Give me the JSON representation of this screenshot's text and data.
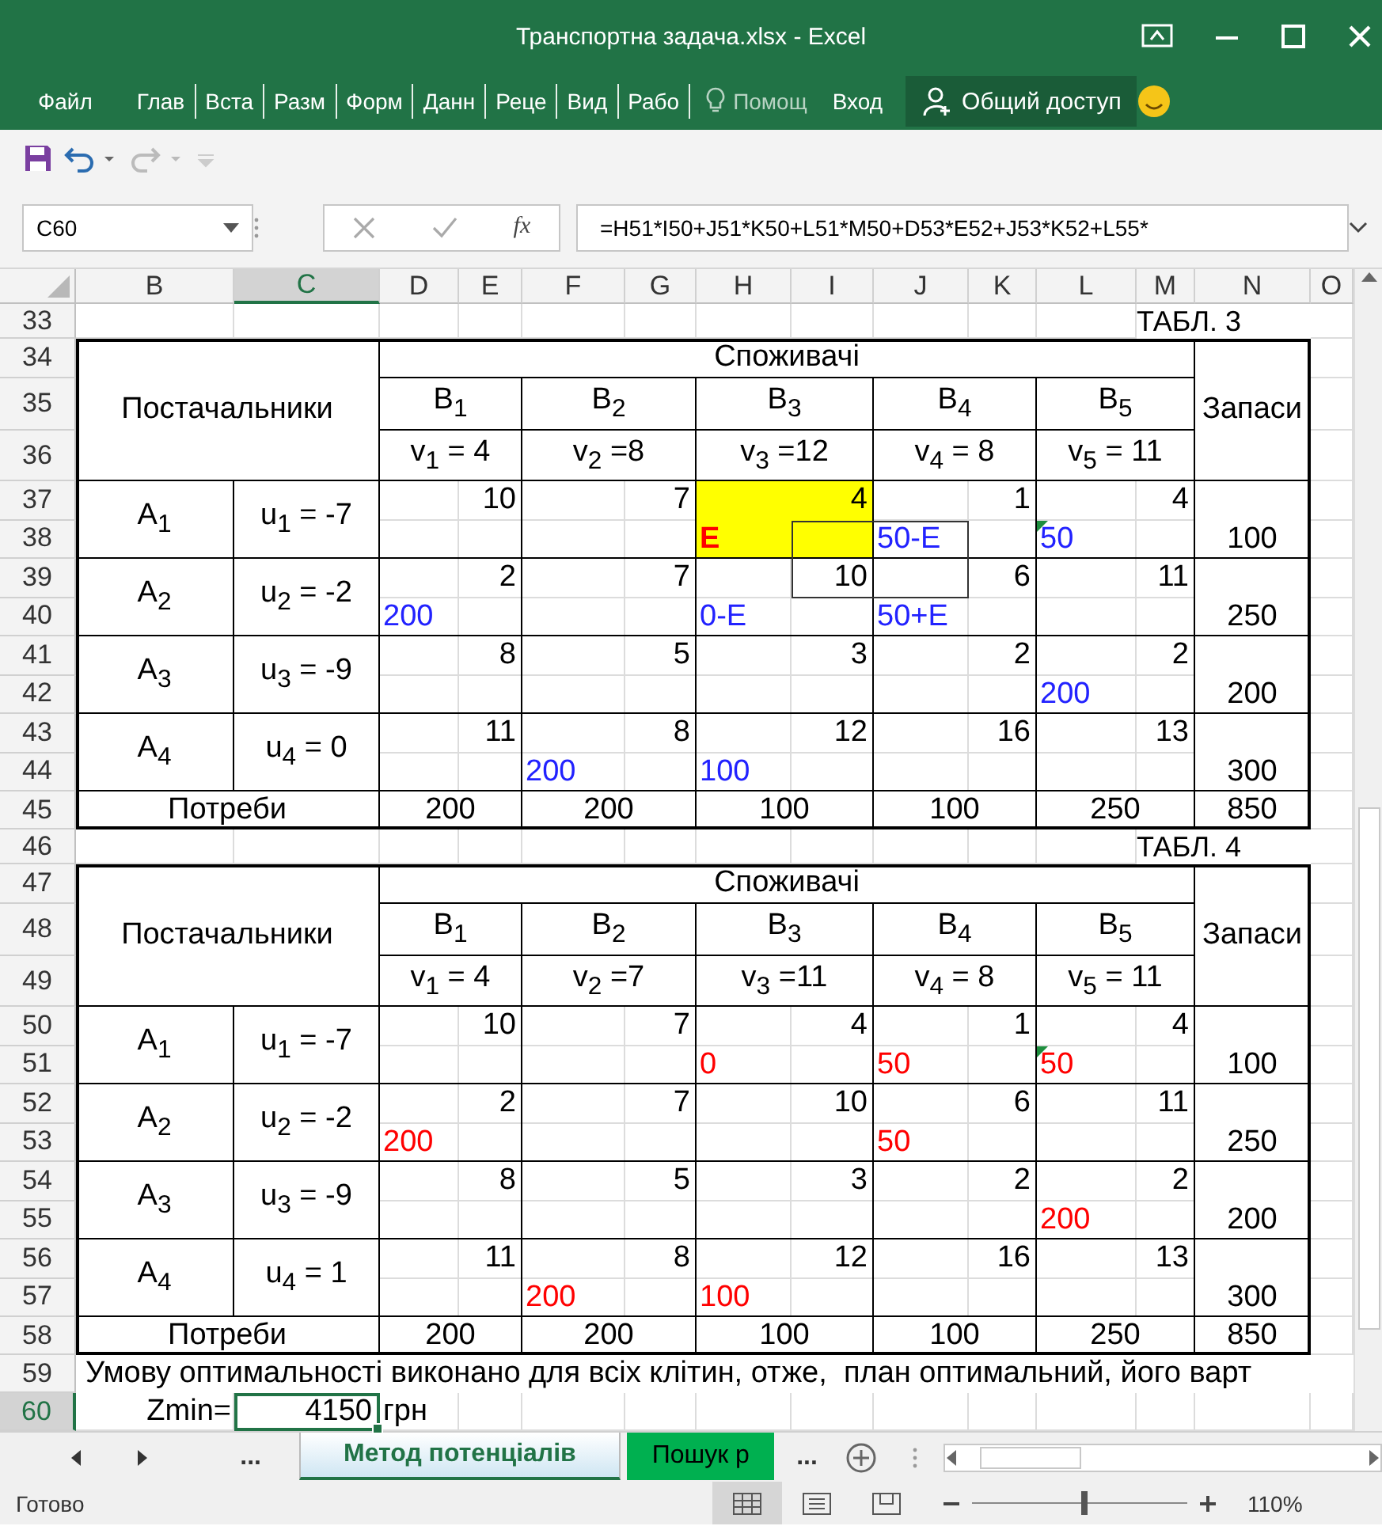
{
  "window": {
    "title": "Транспортна задача.xlsx - Excel"
  },
  "ribbon": {
    "tabs": [
      {
        "label": "Файл"
      },
      {
        "label": "Глав"
      },
      {
        "label": "Вста"
      },
      {
        "label": "Разм"
      },
      {
        "label": "Форм"
      },
      {
        "label": "Данн"
      },
      {
        "label": "Реце"
      },
      {
        "label": "Вид"
      },
      {
        "label": "Рабо"
      }
    ],
    "tell_me": "Помощ",
    "sign_in": "Вход",
    "share": "Общий доступ"
  },
  "formula_bar": {
    "name_box": "C60",
    "function_label": "fx",
    "formula": "=H51*I50+J51*K50+L51*M50+D53*E52+J53*K52+L55*"
  },
  "columns": [
    {
      "label": "B",
      "selected": false
    },
    {
      "label": "C",
      "selected": true
    },
    {
      "label": "D",
      "selected": false
    },
    {
      "label": "E",
      "selected": false
    },
    {
      "label": "F",
      "selected": false
    },
    {
      "label": "G",
      "selected": false
    },
    {
      "label": "H",
      "selected": false
    },
    {
      "label": "I",
      "selected": false
    },
    {
      "label": "J",
      "selected": false
    },
    {
      "label": "K",
      "selected": false
    },
    {
      "label": "L",
      "selected": false
    },
    {
      "label": "M",
      "selected": false
    },
    {
      "label": "N",
      "selected": false
    },
    {
      "label": "O",
      "selected": false
    }
  ],
  "row_headers": [
    {
      "label": "33",
      "selected": false
    },
    {
      "label": "34",
      "selected": false
    },
    {
      "label": "35",
      "selected": false
    },
    {
      "label": "36",
      "selected": false
    },
    {
      "label": "37",
      "selected": false
    },
    {
      "label": "38",
      "selected": false
    },
    {
      "label": "39",
      "selected": false
    },
    {
      "label": "40",
      "selected": false
    },
    {
      "label": "41",
      "selected": false
    },
    {
      "label": "42",
      "selected": false
    },
    {
      "label": "43",
      "selected": false
    },
    {
      "label": "44",
      "selected": false
    },
    {
      "label": "45",
      "selected": false
    },
    {
      "label": "46",
      "selected": false
    },
    {
      "label": "47",
      "selected": false
    },
    {
      "label": "48",
      "selected": false
    },
    {
      "label": "49",
      "selected": false
    },
    {
      "label": "50",
      "selected": false
    },
    {
      "label": "51",
      "selected": false
    },
    {
      "label": "52",
      "selected": false
    },
    {
      "label": "53",
      "selected": false
    },
    {
      "label": "54",
      "selected": false
    },
    {
      "label": "55",
      "selected": false
    },
    {
      "label": "56",
      "selected": false
    },
    {
      "label": "57",
      "selected": false
    },
    {
      "label": "58",
      "selected": false
    },
    {
      "label": "59",
      "selected": false
    },
    {
      "label": "60",
      "selected": true
    }
  ],
  "tables": [
    {
      "label": "ТАБЛ. 3",
      "suppliers_label": "Постачальники",
      "consumers_label": "Споживачі",
      "stock_label": "Запаси",
      "demand_label": "Потреби",
      "total": "850",
      "cycle_outline": true,
      "consumers": [
        {
          "name": "B$_{1}$",
          "potential": "v$_{1}$ = 4",
          "demand": "200"
        },
        {
          "name": "B$_{2}$",
          "potential": "v$_{2}$ =8",
          "demand": "200"
        },
        {
          "name": "B$_{3}$",
          "potential": "v$_{3}$ =12",
          "demand": "100"
        },
        {
          "name": "B$_{4}$",
          "potential": "v$_{4}$ = 8",
          "demand": "100"
        },
        {
          "name": "B$_{5}$",
          "potential": "v$_{5}$ = 11",
          "demand": "250"
        }
      ],
      "suppliers": [
        {
          "name": "A$_{1}$",
          "potential": "u$_{1}$ = -7",
          "stock": "100",
          "cells": [
            {
              "cost": "10",
              "highlighted": false,
              "flagged": false
            },
            {
              "cost": "7",
              "highlighted": false,
              "flagged": false
            },
            {
              "cost": "4",
              "highlighted": true,
              "flagged": false,
              "amount": {
                "text": "E",
                "color": "#ff0000",
                "bold": true
              }
            },
            {
              "cost": "1",
              "highlighted": false,
              "flagged": false,
              "amount": {
                "text": "50-E",
                "color": "#2222ff",
                "bold": false
              }
            },
            {
              "cost": "4",
              "highlighted": false,
              "flagged": true,
              "amount": {
                "text": "50",
                "color": "#2222ff",
                "bold": false
              }
            }
          ]
        },
        {
          "name": "A$_{2}$",
          "potential": "u$_{2}$ = -2",
          "stock": "250",
          "cells": [
            {
              "cost": "2",
              "highlighted": false,
              "flagged": false,
              "amount": {
                "text": "200",
                "color": "#2222ff",
                "bold": false
              }
            },
            {
              "cost": "7",
              "highlighted": false,
              "flagged": false
            },
            {
              "cost": "10",
              "highlighted": false,
              "flagged": false,
              "amount": {
                "text": "0-E",
                "color": "#2222ff",
                "bold": false
              }
            },
            {
              "cost": "6",
              "highlighted": false,
              "flagged": false,
              "amount": {
                "text": "50+E",
                "color": "#2222ff",
                "bold": false
              }
            },
            {
              "cost": "11",
              "highlighted": false,
              "flagged": false
            }
          ]
        },
        {
          "name": "A$_{3}$",
          "potential": "u$_{3}$ = -9",
          "stock": "200",
          "cells": [
            {
              "cost": "8",
              "highlighted": false,
              "flagged": false
            },
            {
              "cost": "5",
              "highlighted": false,
              "flagged": false
            },
            {
              "cost": "3",
              "highlighted": false,
              "flagged": false
            },
            {
              "cost": "2",
              "highlighted": false,
              "flagged": false
            },
            {
              "cost": "2",
              "highlighted": false,
              "flagged": false,
              "amount": {
                "text": "200",
                "color": "#2222ff",
                "bold": false
              }
            }
          ]
        },
        {
          "name": "A$_{4}$",
          "potential": "u$_{4}$ = 0",
          "stock": "300",
          "cells": [
            {
              "cost": "11",
              "highlighted": false,
              "flagged": false
            },
            {
              "cost": "8",
              "highlighted": false,
              "flagged": false,
              "amount": {
                "text": "200",
                "color": "#2222ff",
                "bold": false
              }
            },
            {
              "cost": "12",
              "highlighted": false,
              "flagged": false,
              "amount": {
                "text": "100",
                "color": "#2222ff",
                "bold": false
              }
            },
            {
              "cost": "16",
              "highlighted": false,
              "flagged": false
            },
            {
              "cost": "13",
              "highlighted": false,
              "flagged": false
            }
          ]
        }
      ]
    },
    {
      "label": "ТАБЛ. 4",
      "suppliers_label": "Постачальники",
      "consumers_label": "Споживачі",
      "stock_label": "Запаси",
      "demand_label": "Потреби",
      "total": "850",
      "cycle_outline": false,
      "consumers": [
        {
          "name": "B$_{1}$",
          "potential": "v$_{1}$ = 4",
          "demand": "200"
        },
        {
          "name": "B$_{2}$",
          "potential": "v$_{2}$ =7",
          "demand": "200"
        },
        {
          "name": "B$_{3}$",
          "potential": "v$_{3}$ =11",
          "demand": "100"
        },
        {
          "name": "B$_{4}$",
          "potential": "v$_{4}$ = 8",
          "demand": "100"
        },
        {
          "name": "B$_{5}$",
          "potential": "v$_{5}$ = 11",
          "demand": "250"
        }
      ],
      "suppliers": [
        {
          "name": "A$_{1}$",
          "potential": "u$_{1}$ = -7",
          "stock": "100",
          "cells": [
            {
              "cost": "10",
              "highlighted": false,
              "flagged": false
            },
            {
              "cost": "7",
              "highlighted": false,
              "flagged": false
            },
            {
              "cost": "4",
              "highlighted": false,
              "flagged": false,
              "amount": {
                "text": "0",
                "color": "#ff0000",
                "bold": false
              }
            },
            {
              "cost": "1",
              "highlighted": false,
              "flagged": false,
              "amount": {
                "text": "50",
                "color": "#ff0000",
                "bold": false
              }
            },
            {
              "cost": "4",
              "highlighted": false,
              "flagged": true,
              "amount": {
                "text": "50",
                "color": "#ff0000",
                "bold": false
              }
            }
          ]
        },
        {
          "name": "A$_{2}$",
          "potential": "u$_{2}$ = -2",
          "stock": "250",
          "cells": [
            {
              "cost": "2",
              "highlighted": false,
              "flagged": false,
              "amount": {
                "text": "200",
                "color": "#ff0000",
                "bold": false
              }
            },
            {
              "cost": "7",
              "highlighted": false,
              "flagged": false
            },
            {
              "cost": "10",
              "highlighted": false,
              "flagged": false
            },
            {
              "cost": "6",
              "highlighted": false,
              "flagged": false,
              "amount": {
                "text": "50",
                "color": "#ff0000",
                "bold": false
              }
            },
            {
              "cost": "11",
              "highlighted": false,
              "flagged": false
            }
          ]
        },
        {
          "name": "A$_{3}$",
          "potential": "u$_{3}$ = -9",
          "stock": "200",
          "cells": [
            {
              "cost": "8",
              "highlighted": false,
              "flagged": false
            },
            {
              "cost": "5",
              "highlighted": false,
              "flagged": false
            },
            {
              "cost": "3",
              "highlighted": false,
              "flagged": false
            },
            {
              "cost": "2",
              "highlighted": false,
              "flagged": false
            },
            {
              "cost": "2",
              "highlighted": false,
              "flagged": false,
              "amount": {
                "text": "200",
                "color": "#ff0000",
                "bold": false
              }
            }
          ]
        },
        {
          "name": "A$_{4}$",
          "potential": "u$_{4}$ = 1",
          "stock": "300",
          "cells": [
            {
              "cost": "11",
              "highlighted": false,
              "flagged": false
            },
            {
              "cost": "8",
              "highlighted": false,
              "flagged": false,
              "amount": {
                "text": "200",
                "color": "#ff0000",
                "bold": false
              }
            },
            {
              "cost": "12",
              "highlighted": false,
              "flagged": false,
              "amount": {
                "text": "100",
                "color": "#ff0000",
                "bold": false
              }
            },
            {
              "cost": "16",
              "highlighted": false,
              "flagged": false
            },
            {
              "cost": "13",
              "highlighted": false,
              "flagged": false
            }
          ]
        }
      ]
    }
  ],
  "note": "Умову оптимальності виконано для всіх клітин, отже,  план оптимальний, його варт",
  "result": {
    "label": "Zmin=",
    "value": "4150",
    "unit": "грн"
  },
  "sheet_tabs": {
    "more_left": "...",
    "more_right": "...",
    "tabs": [
      {
        "label": "Метод потенціалів",
        "selected": true
      },
      {
        "label": "Пошук р",
        "selected": false
      }
    ]
  },
  "status_bar": {
    "status": "Готово",
    "zoom": {
      "level": 0.52,
      "reading": "110%"
    }
  }
}
